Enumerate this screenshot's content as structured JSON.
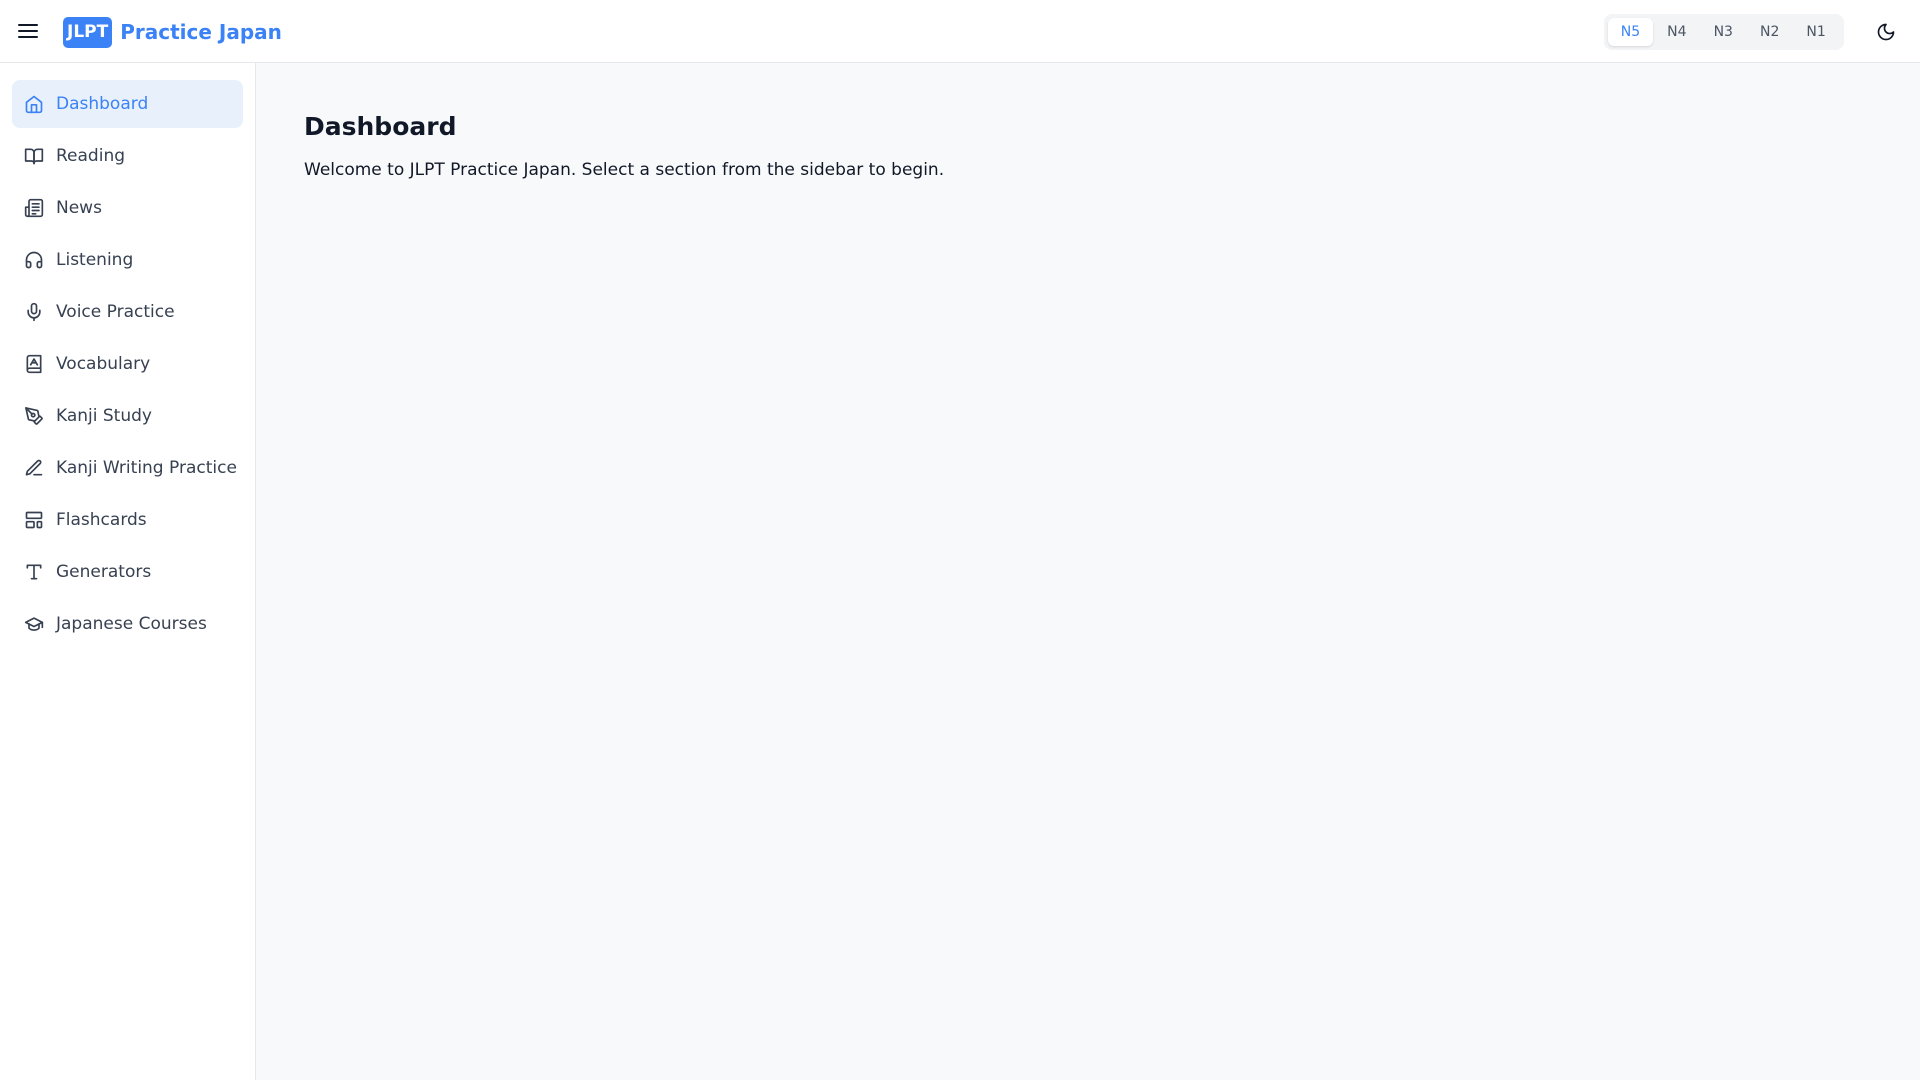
{
  "header": {
    "menu_icon": "hamburger-menu-icon",
    "brand_badge": "JLPT",
    "brand_text": "Practice Japan",
    "levels": [
      {
        "label": "N5",
        "active": true
      },
      {
        "label": "N4",
        "active": false
      },
      {
        "label": "N3",
        "active": false
      },
      {
        "label": "N2",
        "active": false
      },
      {
        "label": "N1",
        "active": false
      }
    ],
    "theme_icon": "moon-icon"
  },
  "sidebar": {
    "items": [
      {
        "label": "Dashboard",
        "icon": "home-icon",
        "active": true
      },
      {
        "label": "Reading",
        "icon": "book-open-icon",
        "active": false
      },
      {
        "label": "News",
        "icon": "newspaper-icon",
        "active": false
      },
      {
        "label": "Listening",
        "icon": "headphones-icon",
        "active": false
      },
      {
        "label": "Voice Practice",
        "icon": "microphone-icon",
        "active": false
      },
      {
        "label": "Vocabulary",
        "icon": "book-a-icon",
        "active": false
      },
      {
        "label": "Kanji Study",
        "icon": "pen-tool-icon",
        "active": false
      },
      {
        "label": "Kanji Writing Practice",
        "icon": "pencil-icon",
        "active": false
      },
      {
        "label": "Flashcards",
        "icon": "layout-template-icon",
        "active": false
      },
      {
        "label": "Generators",
        "icon": "type-icon",
        "active": false
      },
      {
        "label": "Japanese Courses",
        "icon": "graduation-cap-icon",
        "active": false
      }
    ]
  },
  "main": {
    "title": "Dashboard",
    "description": "Welcome to JLPT Practice Japan. Select a section from the sidebar to begin."
  },
  "colors": {
    "accent": "#3b82f6",
    "active_bg": "#e8f0fc",
    "main_bg": "#f8f9fb",
    "border": "#e5e7eb"
  }
}
